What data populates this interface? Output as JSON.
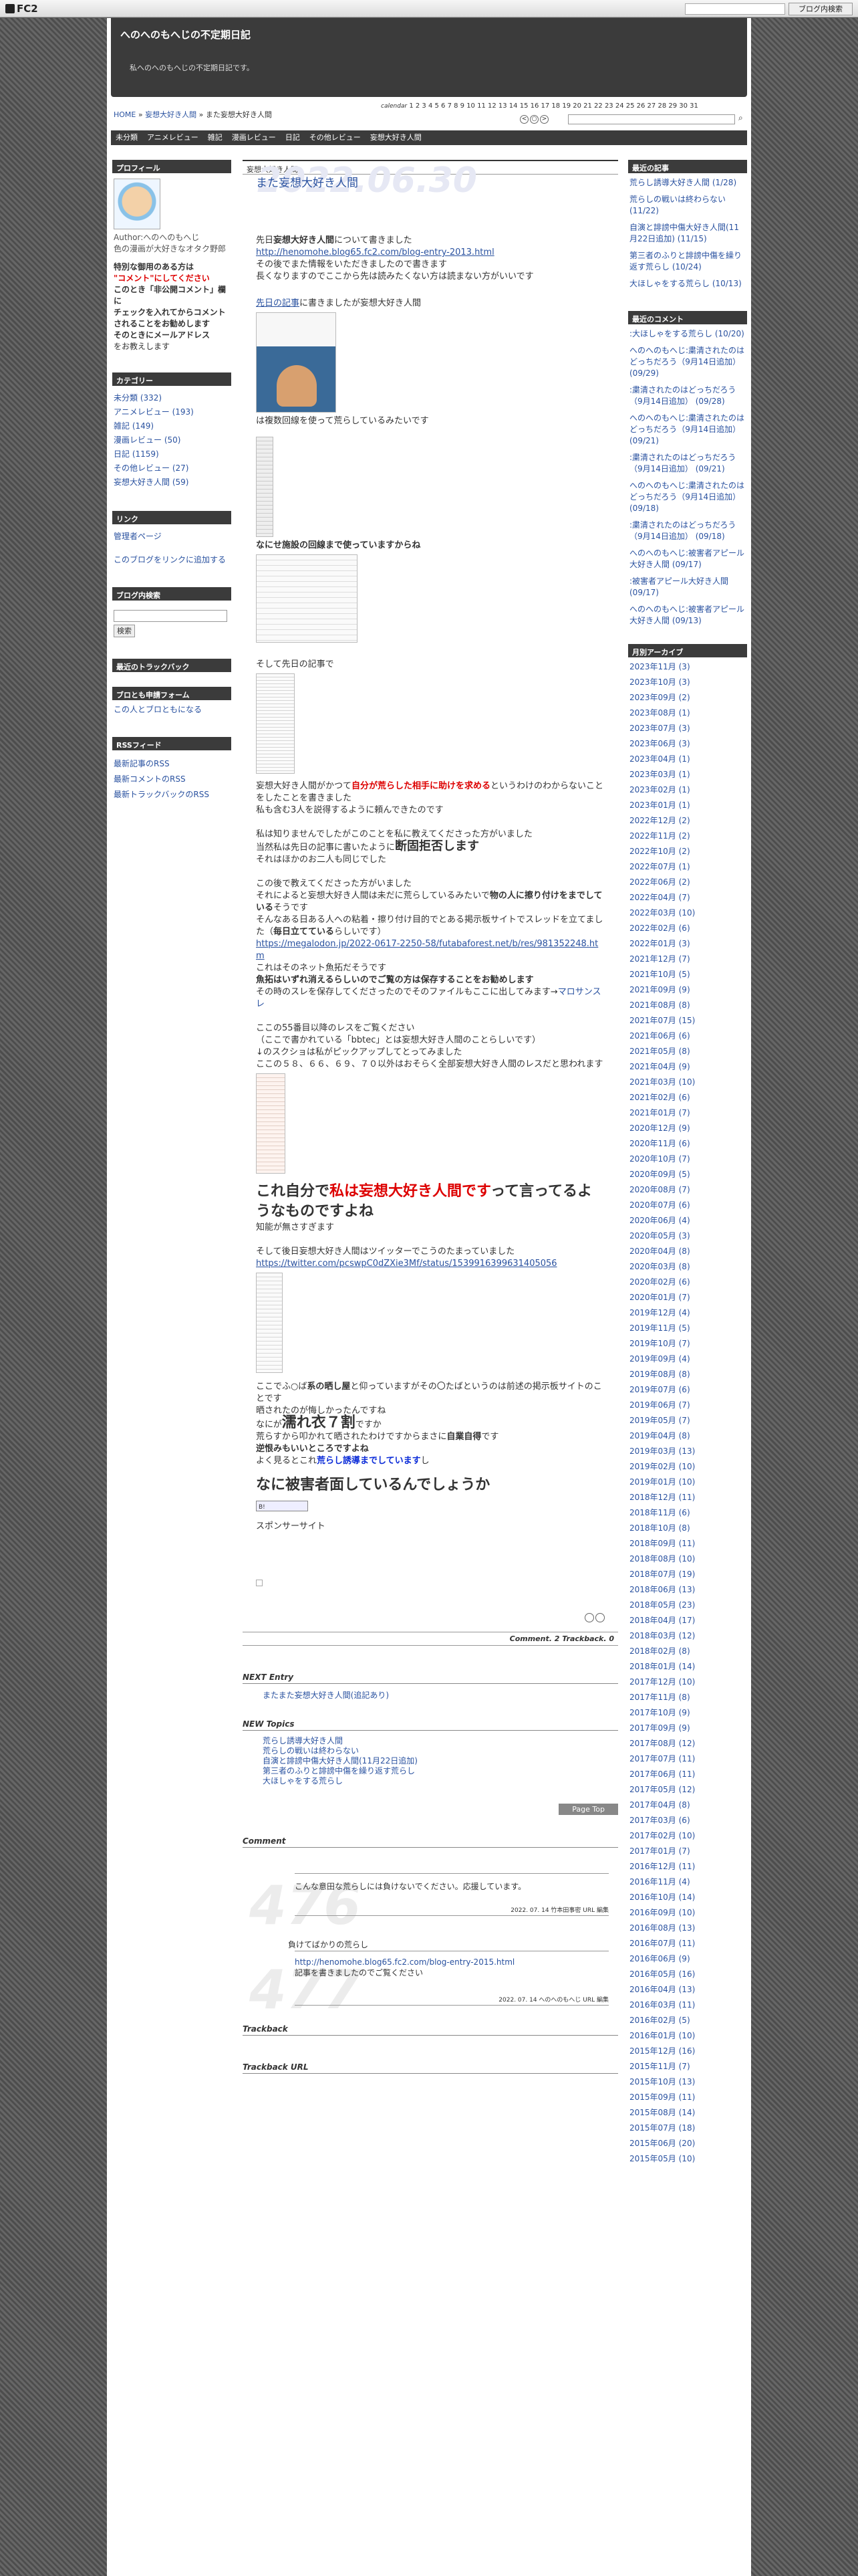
{
  "topbar": {
    "logo": "FC2",
    "search_btn": "ブログ内検索"
  },
  "blog": {
    "title": "へのへのもへじの不定期日記",
    "tagline": "私へのへのもへじの不定期日記です。"
  },
  "breadcrumb": {
    "home": "HOME",
    "sep1": "»",
    "cat": "妄想大好き人間",
    "sep2": "»",
    "cur": "また妄想大好き人間"
  },
  "calendar": {
    "label": "calendar",
    "days": "1 2 3 4 5 6 7 8 9 10 11 12 13 14 15 16 17 18 19 20 21 22 23 24 25 26 27 28 29 30 31"
  },
  "nav": [
    "未分類",
    "アニメレビュー",
    "雑記",
    "漫画レビュー",
    "日記",
    "その他レビュー",
    "妄想大好き人間"
  ],
  "left": {
    "profile_h": "プロフィール",
    "profile_text": "Author:へのへのもへじ\n色の漫画が大好きなオタク野郎",
    "warn1": "特別な御用のある方は",
    "warn2": "\"コメント\"にしてください",
    "warn3": "このとき「非公開コメント」欄に",
    "warn4": "チェックを入れてからコメントされることをお勧めします",
    "warn5": "そのときにメールアドレス",
    "warn6": "をお教えします",
    "cat_h": "カテゴリー",
    "cats": [
      "未分類 (332)",
      "アニメレビュー (193)",
      "雑記 (149)",
      "漫画レビュー (50)",
      "日記 (1159)",
      "その他レビュー (27)",
      "妄想大好き人間 (59)"
    ],
    "link_h": "リンク",
    "links": [
      "管理者ページ",
      "このブログをリンクに追加する"
    ],
    "search_h": "ブログ内検索",
    "search_btn": "検索",
    "tb_h": "最近のトラックバック",
    "friend_h": "ブロとも申請フォーム",
    "friend": "この人とブロともになる",
    "rss_h": "RSSフィード",
    "rss": [
      "最新記事のRSS",
      "最新コメントのRSS",
      "最新トラックバックのRSS"
    ]
  },
  "entry": {
    "cat": "妄想大好き人間",
    "date": "2022.06.30",
    "title": "また妄想大好き人間",
    "p1a": "先日",
    "p1b": "妄想大好き人間",
    "p1c": "について書きました",
    "link1": "http://henomohe.blog65.fc2.com/blog-entry-2013.html",
    "p2": "その後でまた情報をいただきましたので書きます",
    "p3": "長くなりますのでここから先は読みたくない方は読まない方がいいです",
    "p4a": "先日の記事",
    "p4b": "に書きましたが妄想大好き人間",
    "p5": "は複数回線を使って荒らしているみたいです",
    "p6": "なにせ施設の回線まで使っていますからね",
    "p7": "そして先日の記事で",
    "p8a": "妄想大好き人間がかつて",
    "p8b": "自分が荒らした相手に助けを求める",
    "p8c": "というわけのわからないことをしたことを書きました",
    "p9": "私も含む3人を説得するように頼んできたのです",
    "p10": "私は知りませんでしたがこのことを私に教えてくださった方がいました",
    "p11a": "当然私は先日の記事に書いたように",
    "p11b": "断固拒否します",
    "p12": "それはほかのお二人も同じでした",
    "p13": "この後で教えてくださった方がいました",
    "p14a": "それによると妄想大好き人間は未だに荒らしているみたいで",
    "p14b": "物の人に擦り付けをまでしている",
    "p14c": "そうです",
    "p15": "そんなある日ある人への粘着・擦り付け目的でとある掲示板サイトでスレッドを立てました（",
    "p15b": "毎日立てている",
    "p15c": "らしいです）",
    "link2": "https://megalodon.jp/2022-0617-2250-58/futabaforest.net/b/res/981352248.htm",
    "p16": "これはそのネット魚拓だそうです",
    "p17a": "魚拓はいずれ消えるらしいので",
    "p17b": "ご覧の方は保存することをお勧めします",
    "p18": "その時のスレを保存してくださったのでそのファイルもここに出してみます→",
    "p18link": "マロサンスレ",
    "p19": "ここの55番目以降のレスをご覧ください",
    "p20": "（ここで書かれている「bbtec」とは妄想大好き人間のことらしいです）",
    "p21": "↓のスクショは私がピックアップしてとってみました",
    "p22": "ここの５８、６６、６９、７０以外はおそらく全部妄想大好き人間のレスだと思われます",
    "p23a": "これ自分で",
    "p23b": "私は妄想大好き人間です",
    "p23c": "って言ってるようなものですよね",
    "p24": "知能が無さすぎます",
    "p25": "そして後日妄想大好き人間はツイッターでこうのたまっていました",
    "link3": "https://twitter.com/pcswpC0dZXie3Mf/status/1539916399631405056",
    "p26a": "ここでふ○ば",
    "p26b": "系の晒し屋",
    "p26c": "と仰っていますがその〇たばというのは前述の掲示板サイトのことです",
    "p27": "晒されたのが悔しかったんですね",
    "p28a": "なにが",
    "p28b": "濡れ衣７割",
    "p28c": "ですか",
    "p29a": "荒らすから叩かれて晒されたわけですからまさに",
    "p29b": "自業自得",
    "p29c": "です",
    "p30": "逆恨みもいいところですよね",
    "p31a": "よく見るとこれ",
    "p31b": "荒らし誘導までしています",
    "p31c": "し",
    "p32": "なに被害者面しているんでしょうか",
    "hatena": "B!",
    "sponsor": "スポンサーサイト",
    "footer": "Comment. 2 Trackback. 0"
  },
  "next": {
    "h": "NEXT Entry",
    "link": "またまた妄想大好き人間(追記あり)"
  },
  "topics": {
    "h": "NEW Topics",
    "items": [
      "荒らし誘導大好き人間",
      "荒らしの戦いは終わらない",
      "自演と誹謗中傷大好き人間(11月22日追加)",
      "第三者のふりと誹謗中傷を繰り返す荒らし",
      "大ほしゃをする荒らし"
    ]
  },
  "pagetop": "Page Top",
  "comments": {
    "h": "Comment",
    "c1": {
      "num": "476",
      "text": "こんな意田な荒らしには負けないでください。応援しています。",
      "meta": "2022. 07. 14 竹本田事密 URL 編集"
    },
    "c2": {
      "num": "477",
      "title": "負けてばかりの荒らし",
      "link": "http://henomohe.blog65.fc2.com/blog-entry-2015.html",
      "text": "記事を書きましたのでご覧ください",
      "meta": "2022. 07. 14 へのへのもへじ URL 編集"
    }
  },
  "trackback_h": "Trackback",
  "trackback_url_h": "Trackback URL",
  "right": {
    "recent_h": "最近の記事",
    "recent": [
      "荒らし誘導大好き人間 (1/28)",
      "荒らしの戦いは終わらない (11/22)",
      "自演と誹謗中傷大好き人間(11月22日追加) (11/15)",
      "第三者のふりと誹謗中傷を繰り返す荒らし (10/24)",
      "大ほしゃをする荒らし (10/13)"
    ],
    "rc_h": "最近のコメント",
    "rc": [
      ":大ほしゃをする荒らし (10/20)",
      "へのへのもへじ:粛清されたのはどっちだろう（9月14日追加） (09/29)",
      ":粛清されたのはどっちだろう（9月14日追加） (09/28)",
      "へのへのもへじ:粛清されたのはどっちだろう（9月14日追加） (09/21)",
      ":粛清されたのはどっちだろう（9月14日追加） (09/21)",
      "へのへのもへじ:粛清されたのはどっちだろう（9月14日追加） (09/18)",
      ":粛清されたのはどっちだろう（9月14日追加） (09/18)",
      "へのへのもへじ:被害者アピール大好き人間 (09/17)",
      ":被害者アピール大好き人間 (09/17)",
      "へのへのもへじ:被害者アピール大好き人間 (09/13)"
    ],
    "arch_h": "月別アーカイブ",
    "arch": [
      "2023年11月 (3)",
      "2023年10月 (3)",
      "2023年09月 (2)",
      "2023年08月 (1)",
      "2023年07月 (3)",
      "2023年06月 (3)",
      "2023年04月 (1)",
      "2023年03月 (1)",
      "2023年02月 (1)",
      "2023年01月 (1)",
      "2022年12月 (2)",
      "2022年11月 (2)",
      "2022年10月 (2)",
      "2022年07月 (1)",
      "2022年06月 (2)",
      "2022年04月 (7)",
      "2022年03月 (10)",
      "2022年02月 (6)",
      "2022年01月 (3)",
      "2021年12月 (7)",
      "2021年10月 (5)",
      "2021年09月 (9)",
      "2021年08月 (8)",
      "2021年07月 (15)",
      "2021年06月 (6)",
      "2021年05月 (8)",
      "2021年04月 (9)",
      "2021年03月 (10)",
      "2021年02月 (6)",
      "2021年01月 (7)",
      "2020年12月 (9)",
      "2020年11月 (6)",
      "2020年10月 (7)",
      "2020年09月 (5)",
      "2020年08月 (7)",
      "2020年07月 (6)",
      "2020年06月 (4)",
      "2020年05月 (3)",
      "2020年04月 (8)",
      "2020年03月 (8)",
      "2020年02月 (6)",
      "2020年01月 (7)",
      "2019年12月 (4)",
      "2019年11月 (5)",
      "2019年10月 (7)",
      "2019年09月 (4)",
      "2019年08月 (8)",
      "2019年07月 (6)",
      "2019年06月 (7)",
      "2019年05月 (7)",
      "2019年04月 (8)",
      "2019年03月 (13)",
      "2019年02月 (10)",
      "2019年01月 (10)",
      "2018年12月 (11)",
      "2018年11月 (6)",
      "2018年10月 (8)",
      "2018年09月 (11)",
      "2018年08月 (10)",
      "2018年07月 (19)",
      "2018年06月 (13)",
      "2018年05月 (23)",
      "2018年04月 (17)",
      "2018年03月 (12)",
      "2018年02月 (8)",
      "2018年01月 (14)",
      "2017年12月 (10)",
      "2017年11月 (8)",
      "2017年10月 (9)",
      "2017年09月 (9)",
      "2017年08月 (12)",
      "2017年07月 (11)",
      "2017年06月 (11)",
      "2017年05月 (12)",
      "2017年04月 (8)",
      "2017年03月 (6)",
      "2017年02月 (10)",
      "2017年01月 (7)",
      "2016年12月 (11)",
      "2016年11月 (4)",
      "2016年10月 (14)",
      "2016年09月 (10)",
      "2016年08月 (13)",
      "2016年07月 (11)",
      "2016年06月 (9)",
      "2016年05月 (16)",
      "2016年04月 (13)",
      "2016年03月 (11)",
      "2016年02月 (5)",
      "2016年01月 (10)",
      "2015年12月 (16)",
      "2015年11月 (7)",
      "2015年10月 (13)",
      "2015年09月 (11)",
      "2015年08月 (14)",
      "2015年07月 (18)",
      "2015年06月 (20)",
      "2015年05月 (10)"
    ]
  }
}
